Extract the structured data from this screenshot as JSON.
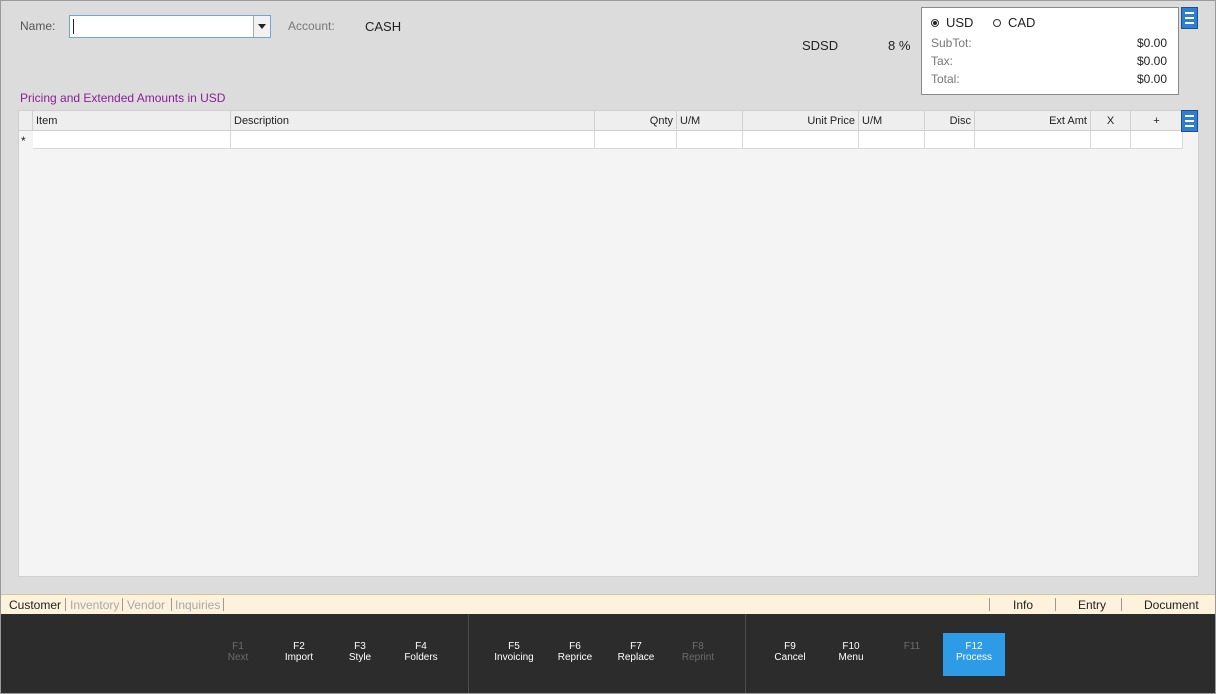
{
  "header": {
    "name_label": "Name:",
    "name_value": "",
    "account_label": "Account:",
    "account_value": "CASH",
    "tax_code": "SDSD",
    "tax_rate": "8 %"
  },
  "totals": {
    "currency_options": [
      "USD",
      "CAD"
    ],
    "selected_currency": "USD",
    "rows": [
      {
        "label": "SubTot:",
        "value": "$0.00"
      },
      {
        "label": "Tax:",
        "value": "$0.00"
      },
      {
        "label": "Total:",
        "value": "$0.00"
      }
    ]
  },
  "pricing_label": "Pricing and Extended Amounts in USD",
  "grid": {
    "columns": [
      "Item",
      "Description",
      "Qnty",
      "U/M",
      "Unit Price",
      "U/M",
      "Disc",
      "Ext Amt",
      "X",
      "+"
    ],
    "new_row_marker": "*"
  },
  "nav": {
    "left_tabs": [
      "Customer",
      "Inventory",
      "Vendor",
      "Inquiries"
    ],
    "active_tab": "Customer",
    "right_tabs": [
      "Info",
      "Entry",
      "Document"
    ]
  },
  "function_keys": [
    {
      "key": "F1",
      "label": "Next",
      "enabled": false
    },
    {
      "key": "F2",
      "label": "Import",
      "enabled": true
    },
    {
      "key": "F3",
      "label": "Style",
      "enabled": true
    },
    {
      "key": "F4",
      "label": "Folders",
      "enabled": true
    },
    {
      "key": "F5",
      "label": "Invoicing",
      "enabled": true
    },
    {
      "key": "F6",
      "label": "Reprice",
      "enabled": true
    },
    {
      "key": "F7",
      "label": "Replace",
      "enabled": true
    },
    {
      "key": "F8",
      "label": "Reprint",
      "enabled": false
    },
    {
      "key": "F9",
      "label": "Cancel",
      "enabled": true
    },
    {
      "key": "F10",
      "label": "Menu",
      "enabled": true
    },
    {
      "key": "F11",
      "label": "",
      "enabled": false
    },
    {
      "key": "F12",
      "label": "Process",
      "enabled": true
    }
  ],
  "colors": {
    "accent": "#2e9be6",
    "pricing_label": "#8b2096",
    "function_bar": "#2c2c2c",
    "nav_bar": "#fdf2dc"
  }
}
